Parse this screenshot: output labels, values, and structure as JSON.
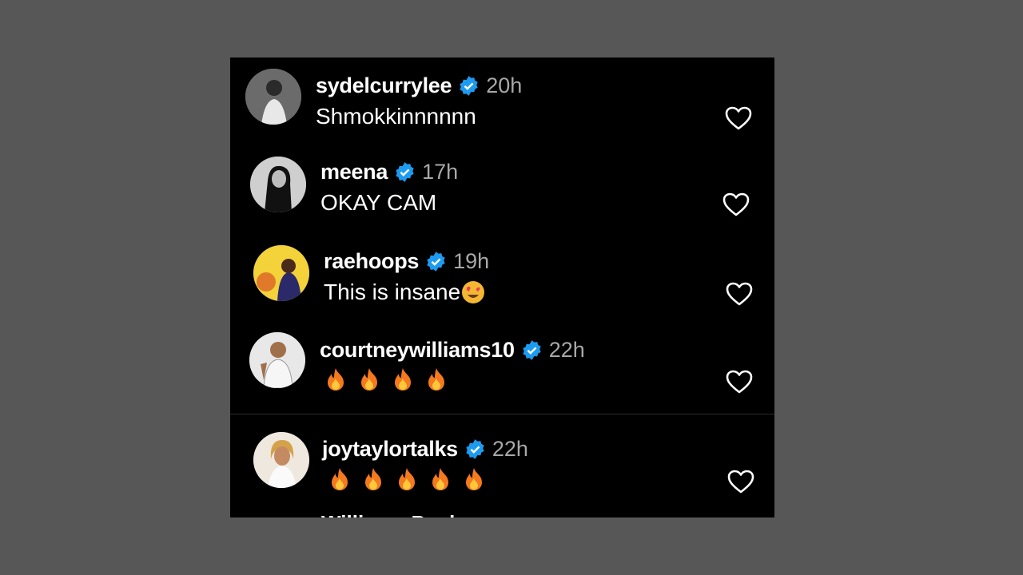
{
  "comments": [
    {
      "username": "sydelcurrylee",
      "time": "20h",
      "text": "Shmokkinnnnnn",
      "avatar": "avatar-woman-white-dress",
      "verified": true
    },
    {
      "username": "meena",
      "time": "17h",
      "text": "OKAY CAM",
      "avatar": "avatar-woman-bw-photo",
      "verified": true
    },
    {
      "username": "raehoops",
      "time": "19h",
      "text": "This is insane",
      "emoji": "heart-eyes-emoji",
      "avatar": "avatar-woman-yellow-bg",
      "verified": true
    },
    {
      "username": "courtneywilliams10",
      "time": "22h",
      "text": "",
      "emoji_repeat": {
        "icon": "fire-emoji",
        "count": 4
      },
      "avatar": "avatar-player-jersey",
      "verified": true
    },
    {
      "username": "joytaylortalks",
      "time": "22h",
      "text": "",
      "emoji_repeat": {
        "icon": "fire-emoji",
        "count": 5
      },
      "avatar": "avatar-woman-blonde",
      "verified": true
    }
  ],
  "truncated_next_username": "Williams Paul",
  "icons": {
    "verified": "verified-badge-icon",
    "like": "heart-outline-icon"
  },
  "colors": {
    "background": "#575757",
    "panel": "#000000",
    "verified": "#1d9bf0",
    "time": "#a8a8a8"
  }
}
